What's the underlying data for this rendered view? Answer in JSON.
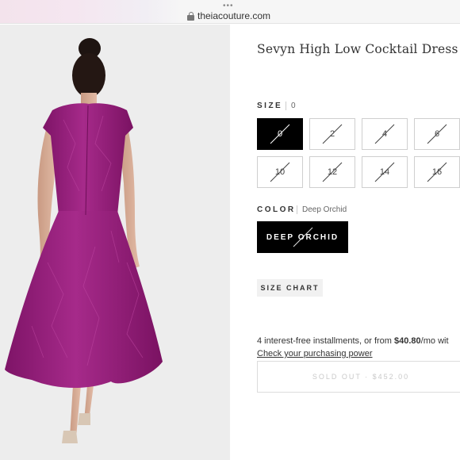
{
  "browser": {
    "dots": "•••",
    "url": "theiacouture.com"
  },
  "product": {
    "title": "Sevyn High Low Cocktail Dress",
    "size_label": "SIZE",
    "size_selected": "0",
    "sizes": [
      {
        "label": "0",
        "selected": true,
        "unavailable": true
      },
      {
        "label": "2",
        "selected": false,
        "unavailable": true
      },
      {
        "label": "4",
        "selected": false,
        "unavailable": true
      },
      {
        "label": "6",
        "selected": false,
        "unavailable": true
      },
      {
        "label": "10",
        "selected": false,
        "unavailable": true
      },
      {
        "label": "12",
        "selected": false,
        "unavailable": true
      },
      {
        "label": "14",
        "selected": false,
        "unavailable": true
      },
      {
        "label": "16",
        "selected": false,
        "unavailable": true
      }
    ],
    "color_label": "COLOR",
    "color_selected": "Deep Orchid",
    "color_button": "DEEP ORCHID",
    "size_chart": "SIZE CHART",
    "installments_prefix": "4 interest-free installments, or from ",
    "installments_amount": "$40.80",
    "installments_suffix": "/mo wit",
    "purchasing_power_link": "Check your purchasing power",
    "sold_out_button": "SOLD OUT  ·  $452.00"
  },
  "colors": {
    "dress": "#9b1f80",
    "selected_bg": "#000000",
    "photo_bg": "#ededed"
  }
}
